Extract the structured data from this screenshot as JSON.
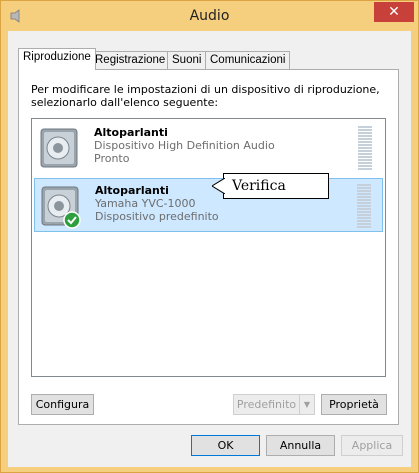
{
  "window": {
    "title": "Audio",
    "close_glyph": "✕"
  },
  "tabs": [
    {
      "label": "Riproduzione",
      "active": true
    },
    {
      "label": "Registrazione",
      "active": false
    },
    {
      "label": "Suoni",
      "active": false
    },
    {
      "label": "Comunicazioni",
      "active": false
    }
  ],
  "panel": {
    "instructions": "Per modificare le impostazioni di un dispositivo di riproduzione, selezionarlo dall'elenco seguente:"
  },
  "devices": [
    {
      "name": "Altoparlanti",
      "line1": "Dispositivo High Definition Audio",
      "line2": "Pronto",
      "icon": "speaker-icon",
      "selected": false,
      "default": false
    },
    {
      "name": "Altoparlanti",
      "line1": "Yamaha YVC-1000",
      "line2": "Dispositivo predefinito",
      "icon": "speaker-icon",
      "selected": true,
      "default": true
    }
  ],
  "callout": {
    "text": "Verifica"
  },
  "panel_buttons": {
    "configure": "Configura",
    "set_default": "Predefinito",
    "set_default_arrow": "▼",
    "properties": "Proprietà"
  },
  "dialog_buttons": {
    "ok": "OK",
    "cancel": "Annulla",
    "apply": "Applica"
  },
  "colors": {
    "title_bar": "#f5ce7e",
    "close_button": "#c7403a",
    "selection": "#cde8ff",
    "default_check": "#2e9f3e"
  }
}
